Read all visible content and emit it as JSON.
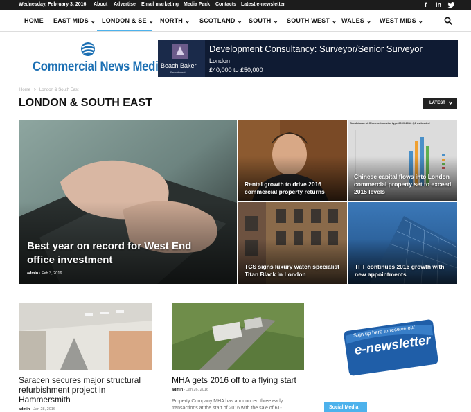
{
  "topbar": {
    "date": "Wednesday, February 3, 2016",
    "links": [
      "About",
      "Advertise",
      "Email marketing",
      "Media Pack",
      "Contacts",
      "Latest e-newsletter"
    ],
    "social": {
      "facebook": "f",
      "linkedin": "in",
      "twitter": "t"
    }
  },
  "nav": {
    "items": [
      "HOME",
      "EAST MIDS ⌄",
      "LONDON & SE ⌄",
      "NORTH ⌄",
      "SCOTLAND ⌄",
      "SOUTH ⌄",
      "SOUTH WEST ⌄",
      "WALES ⌄",
      "WEST MIDS ⌄"
    ],
    "active_index": 2,
    "search_icon": "search-icon"
  },
  "logo": {
    "text": "Commercial News Media"
  },
  "ad": {
    "brand": "Beach Baker",
    "brand_sub": "Recruitment",
    "headline": "Development Consultancy: Surveyor/Senior Surveyor",
    "location": "London",
    "salary": "£40,000 to £50,000"
  },
  "breadcrumb": {
    "home": "Home",
    "sep": ">",
    "current": "London & South East"
  },
  "page_title": "LONDON & SOUTH EAST",
  "latest_button": "LATEST",
  "hero": {
    "main": {
      "title": "Best year on record for West End office investment",
      "author": "admin",
      "date": "Feb 3, 2016"
    },
    "tile2": {
      "title": "Rental growth to drive 2016 commercial property returns"
    },
    "tile3": {
      "title": "Chinese capital flows into London commercial property set to exceed 2015 levels",
      "chart_caption": "Breakdown of Chinese investor type 2009-2016 Q1 estimated"
    },
    "tile4": {
      "title": "TCS signs luxury watch specialist Titan Black in London"
    },
    "tile5": {
      "title": "TFT continues 2016 growth with new appointments"
    }
  },
  "articles": [
    {
      "title": "Saracen secures major structural refurbishment project in Hammersmith",
      "author": "admin",
      "date": "Jan 28, 2016"
    },
    {
      "title": "MHA gets 2016 off to a flying start",
      "author": "admin",
      "date": "Jan 26, 2016",
      "excerpt": "Property Company MHA has announced three early transactions at the start of 2016 with the sale of 61-"
    }
  ],
  "newsletter": {
    "line1": "Sign up here to receive our",
    "line2": "e-newsletter"
  },
  "social_media_label": "Social Media",
  "colors": {
    "accent": "#4db2ec",
    "logo_blue": "#1b6fb3",
    "topbar": "#1c1c1c"
  }
}
